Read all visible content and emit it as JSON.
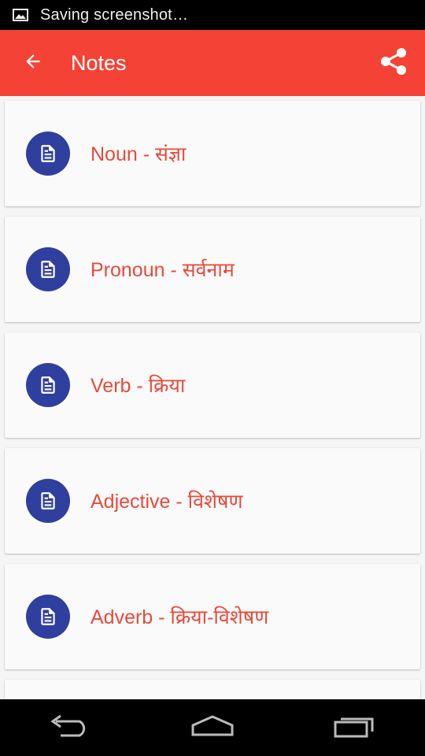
{
  "status_bar": {
    "notification_icon": "image-icon",
    "text": "Saving screenshot…"
  },
  "app_bar": {
    "back_icon": "arrow-back-icon",
    "title": "Notes",
    "share_icon": "share-icon",
    "background": "#f44336"
  },
  "notes": {
    "items": [
      {
        "label": "Noun - संज्ञा",
        "icon": "document-icon"
      },
      {
        "label": "Pronoun - सर्वनाम",
        "icon": "document-icon"
      },
      {
        "label": "Verb - क्रिया",
        "icon": "document-icon"
      },
      {
        "label": "Adjective - विशेषण",
        "icon": "document-icon"
      },
      {
        "label": "Adverb - क्रिया-विशेषण",
        "icon": "document-icon"
      }
    ],
    "label_color": "#e84a3b",
    "icon_color": "#2f3f9e"
  },
  "nav_bar": {
    "back_icon": "nav-back-icon",
    "home_icon": "nav-home-icon",
    "recents_icon": "nav-recents-icon"
  }
}
